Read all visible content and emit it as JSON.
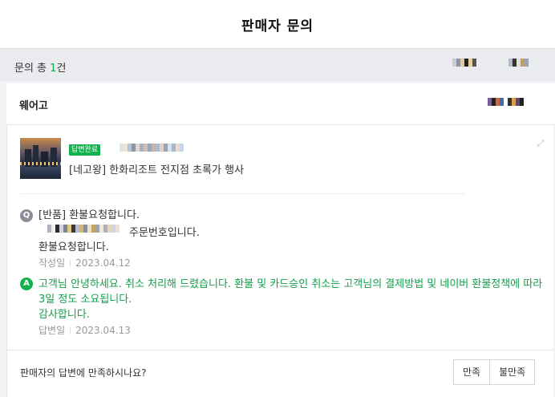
{
  "header": {
    "title": "판매자 문의"
  },
  "summary": {
    "prefix": "문의 총 ",
    "count": "1",
    "suffix": "건"
  },
  "seller": {
    "name": "웨어고"
  },
  "inquiry": {
    "status_badge": "답변완료",
    "product_name": "[네고왕] 한화리조트 전지점 초록가 행사",
    "question": {
      "line1": "[반품] 환불요청합니다.",
      "line2": "주문번호입니다.",
      "line3": "환불요청합니다.",
      "meta_label": "작성일",
      "date": "2023.04.12"
    },
    "answer": {
      "text": "고객님 안녕하세요. 취소 처리해 드렸습니다. 환불 및 카드승인 취소는 고객님의 결제방법 및 네이버 환불정책에 따라 3일 정도 소요됩니다.",
      "thanks": "감사합니다.",
      "meta_label": "답변일",
      "date": "2023.04.13"
    }
  },
  "footer": {
    "question": "판매자의 답변에 만족하시나요?",
    "satisfied_label": "만족",
    "unsatisfied_label": "불만족"
  },
  "icons": {
    "question": "Q",
    "answer": "A",
    "expand": "expand-icon"
  },
  "colors": {
    "accent_green": "#13b04e",
    "summary_bg": "#e9ebee"
  }
}
